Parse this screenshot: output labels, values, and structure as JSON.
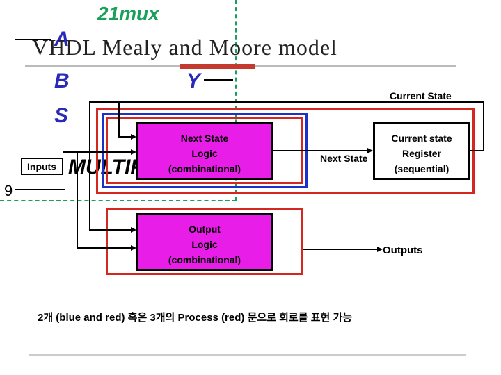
{
  "background": {
    "mux_label": "21mux",
    "a": "A",
    "b": "B",
    "s": "S",
    "y": "Y",
    "multip": "MULTIP",
    "nine": "9"
  },
  "title": "VHDL Mealy and Moore model",
  "labels": {
    "current_state": "Current State",
    "inputs": "Inputs",
    "next_state": "Next State",
    "outputs": "Outputs"
  },
  "blocks": {
    "next_state_logic": {
      "line1": "Next State",
      "line2": "Logic",
      "line3": "(combinational)"
    },
    "current_state_register": {
      "line1": "Current state",
      "line2": "Register",
      "line3": "(sequential)"
    },
    "output_logic": {
      "line1": "Output",
      "line2": "Logic",
      "line3": "(combinational)"
    }
  },
  "caption": "2개 (blue and red) 혹은 3개의 Process (red) 문으로 회로를 표현 가능"
}
